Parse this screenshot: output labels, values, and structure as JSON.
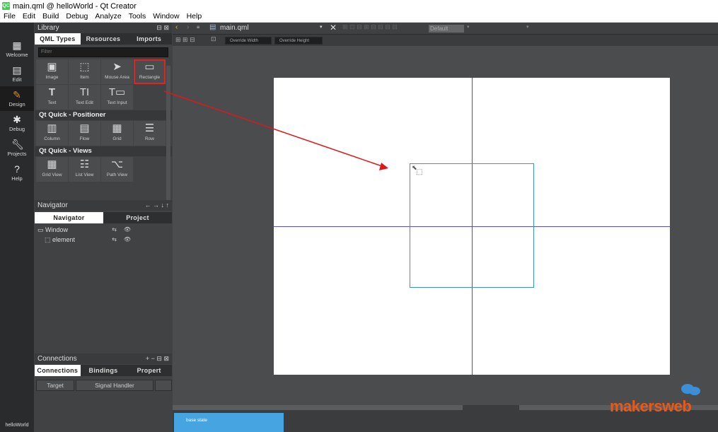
{
  "window": {
    "title": "main.qml @ helloWorld - Qt Creator",
    "logo": "QC"
  },
  "menu": [
    "File",
    "Edit",
    "Build",
    "Debug",
    "Analyze",
    "Tools",
    "Window",
    "Help"
  ],
  "modes": [
    {
      "label": "Welcome",
      "icon": "grid-icon"
    },
    {
      "label": "Edit",
      "icon": "document-icon"
    },
    {
      "label": "Design",
      "icon": "pencil-icon",
      "active": true
    },
    {
      "label": "Debug",
      "icon": "bug-icon"
    },
    {
      "label": "Projects",
      "icon": "wrench-icon"
    },
    {
      "label": "Help",
      "icon": "help-icon"
    }
  ],
  "mode_footer": "helloWorld",
  "library": {
    "title": "Library",
    "tabs": [
      "QML Types",
      "Resources",
      "Imports"
    ],
    "filter_placeholder": "Filter",
    "items_basic": [
      "Image",
      "Item",
      "Mouse Area",
      "Rectangle",
      "Text",
      "Text Edit",
      "Text Input"
    ],
    "section_positioner": "Qt Quick - Positioner",
    "items_positioner": [
      "Column",
      "Flow",
      "Grid",
      "Row"
    ],
    "section_views": "Qt Quick - Views",
    "items_views": [
      "Grid View",
      "List View",
      "Path View"
    ]
  },
  "navigator": {
    "title": "Navigator",
    "tabs": [
      "Navigator",
      "Project"
    ],
    "tree": [
      "Window",
      "element"
    ]
  },
  "connections": {
    "title": "Connections",
    "tabs": [
      "Connections",
      "Bindings",
      "Propert"
    ],
    "columns": [
      "Target",
      "Signal Handler"
    ]
  },
  "editor": {
    "file": "main.qml",
    "override_width": "Override Width",
    "override_height": "Override Height",
    "state_dropdown": "Default"
  },
  "states": {
    "base": "base state"
  },
  "watermark": "makersweb"
}
